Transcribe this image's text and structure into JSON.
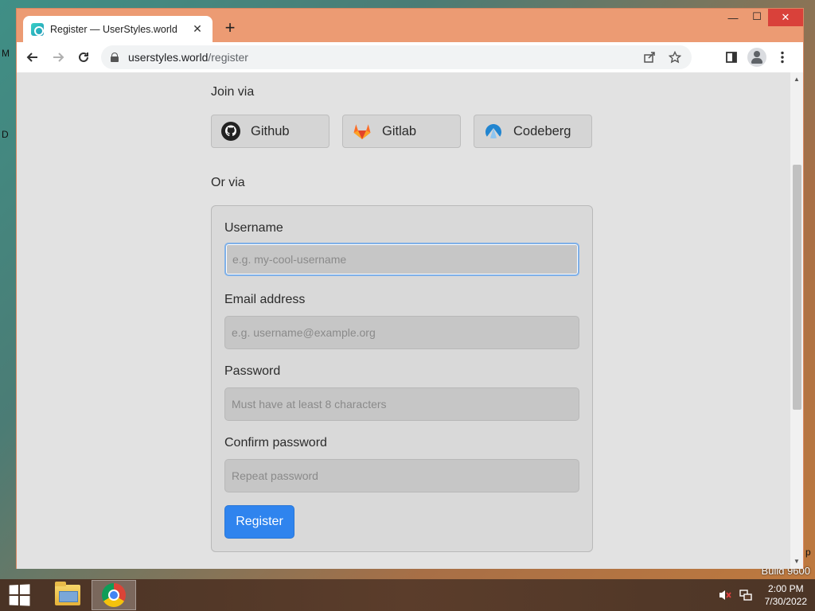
{
  "desktop": {
    "edge_text_1": "M",
    "edge_text_2": "D",
    "edge_text_3": "p",
    "build_text": "Build 9600"
  },
  "browser": {
    "tab_title": "Register — UserStyles.world",
    "tab_close_glyph": "✕",
    "new_tab_glyph": "+",
    "minimize_glyph": "—",
    "maximize_glyph": "☐",
    "close_glyph": "✕",
    "url_host": "userstyles.world",
    "url_path": "/register"
  },
  "page": {
    "join_via_label": "Join via",
    "oauth_buttons": [
      {
        "label": "Github",
        "icon": "github-icon"
      },
      {
        "label": "Gitlab",
        "icon": "gitlab-icon"
      },
      {
        "label": "Codeberg",
        "icon": "codeberg-icon"
      }
    ],
    "or_via_label": "Or via",
    "form": {
      "username_label": "Username",
      "username_placeholder": "e.g. my-cool-username",
      "email_label": "Email address",
      "email_placeholder": "e.g. username@example.org",
      "password_label": "Password",
      "password_placeholder": "Must have at least 8 characters",
      "confirm_label": "Confirm password",
      "confirm_placeholder": "Repeat password",
      "submit_label": "Register"
    }
  },
  "taskbar": {
    "time": "2:00 PM",
    "date": "7/30/2022"
  }
}
